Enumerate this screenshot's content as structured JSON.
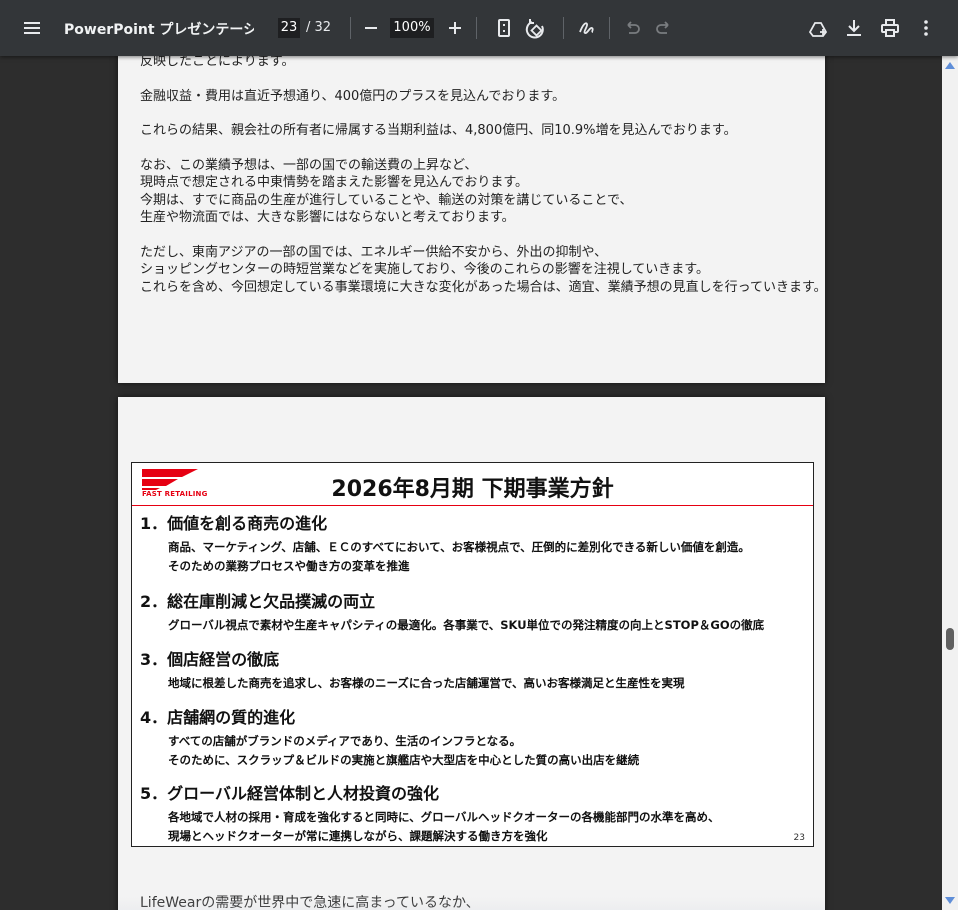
{
  "toolbar": {
    "title": "PowerPoint プレゼンテーシ...",
    "current_page": "23",
    "total_pages": "/ 32",
    "zoom": "100%"
  },
  "notes_top": [
    "反映したことによります。",
    "金融収益・費用は直近予想通り、400億円のプラスを見込んでおります。",
    "これらの結果、親会社の所有者に帰属する当期利益は、4,800億円、同10.9%増を見込んでおります。",
    "なお、この業績予想は、一部の国での輸送費の上昇など、",
    "現時点で想定される中東情勢を踏まえた影響を見込んでおります。",
    "今期は、すでに商品の生産が進行していることや、輸送の対策を講じていることで、",
    "生産や物流面では、大きな影響にはならないと考えております。",
    "ただし、東南アジアの一部の国では、エネルギー供給不安から、外出の抑制や、",
    "ショッピングセンターの時短営業などを実施しており、今後のこれらの影響を注視していきます。",
    "これらを含め、今回想定している事業環境に大きな変化があった場合は、適宜、業績予想の見直しを行っていきます。"
  ],
  "slide": {
    "logo_text": "FAST RETAILING",
    "title": "2026年8月期 下期事業方針",
    "sections": [
      {
        "heading": "1．価値を創る商売の進化",
        "lines": [
          "商品、マーケティング、店舗、ＥＣのすべてにおいて、お客様視点で、圧倒的に差別化できる新しい価値を創造。",
          "そのための業務プロセスや働き方の変革を推進"
        ]
      },
      {
        "heading": "2．総在庫削減と欠品撲滅の両立",
        "lines": [
          "グローバル視点で素材や生産キャパシティの最適化。各事業で、SKU単位での発注精度の向上とSTOP＆GOの徹底"
        ]
      },
      {
        "heading": "3．個店経営の徹底",
        "lines": [
          "地域に根差した商売を追求し、お客様のニーズに合った店舗運営で、高いお客様満足と生産性を実現"
        ]
      },
      {
        "heading": "4．店舗網の質的進化",
        "lines": [
          "すべての店舗がブランドのメディアであり、生活のインフラとなる。",
          "そのために、スクラップ＆ビルドの実施と旗艦店や大型店を中心とした質の高い出店を継続"
        ]
      },
      {
        "heading": "5．グローバル経営体制と人材投資の強化",
        "lines": [
          "各地域で人材の採用・育成を強化すると同時に、グローバルヘッドクオーターの各機能部門の水準を高め、",
          "現場とヘッドクオーターが常に連携しながら、課題解決する働き方を強化"
        ]
      }
    ],
    "page_number": "23"
  },
  "notes_bottom": "LifeWearの需要が世界中で急速に高まっているなか、"
}
